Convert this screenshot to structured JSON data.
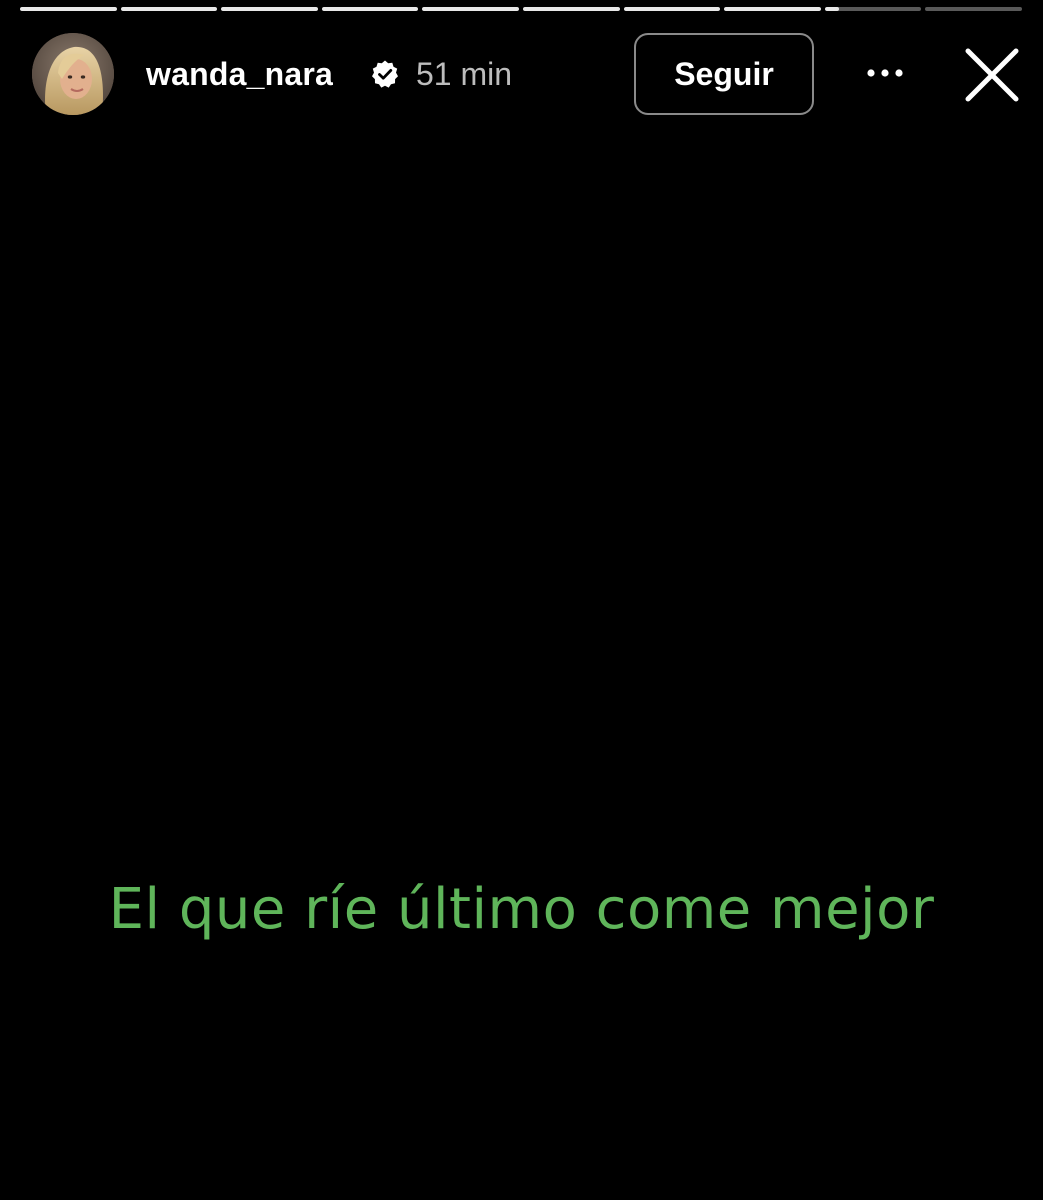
{
  "story": {
    "progress": {
      "segments": [
        1,
        1,
        1,
        1,
        1,
        1,
        1,
        1,
        0.15,
        0
      ],
      "fill_color": "#e8e8e8",
      "track_color": "rgba(255,255,255,0.35)"
    },
    "header": {
      "username": "wanda_nara",
      "verified_icon": "verified-badge-icon",
      "timestamp": "51 min",
      "follow_label": "Seguir",
      "more_icon": "more-horizontal-icon",
      "close_icon": "close-icon"
    },
    "content": {
      "text": "El que ríe último come mejor",
      "text_color": "#5fb55a",
      "background": "#000000"
    }
  }
}
